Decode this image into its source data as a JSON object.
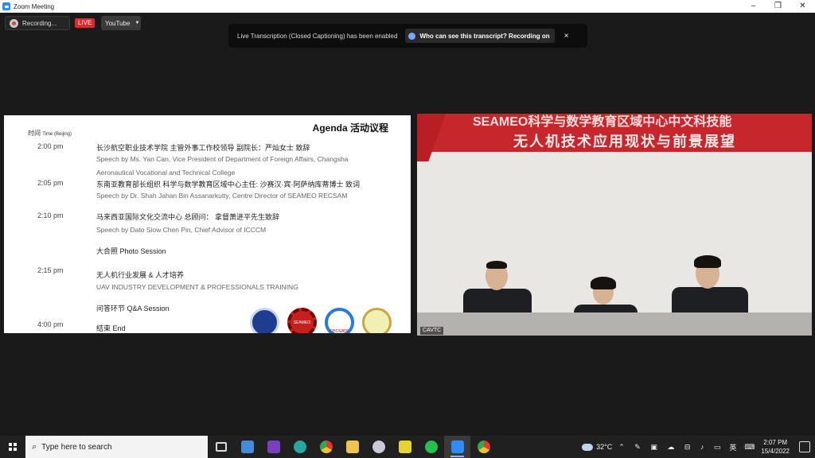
{
  "window": {
    "title": "Zoom Meeting"
  },
  "top_controls": {
    "recording_label": "Recording...",
    "live_badge": "LIVE",
    "stream_target": "YouTube"
  },
  "notification": {
    "message": "Live Transcription (Closed Captioning) has been enabled",
    "who_button": "Who can see this transcript? Recording on",
    "close": "×"
  },
  "slide": {
    "title": "Agenda 活动议程",
    "time_header": "时间",
    "time_header_sub": "Time (Beijing)",
    "items": [
      {
        "time": "2:00 pm",
        "zh": "长沙航空职业技术学院 主管外事工作校领导 副院长：严灿女士 致辞",
        "en": "Speech by Ms. Yan Can, Vice President of Department of Foreign Affairs, Changsha",
        "en2": "Aeronautical Vocational and Technical College"
      },
      {
        "time": "2:05 pm",
        "zh": "东南亚教育部长组织 科学与数学教育区域中心主任: 沙赛汉·宾·阿萨纳库蒂博士 致词",
        "en": "Speech by Dr. Shah Jahan Bin Assanarkutty, Centre Director of SEAMEO RECSAM",
        "en2": ""
      },
      {
        "time": "2:10 pm",
        "zh": "马来西亚国际文化交流中心 总顾问： 拿督萧进平先生致辞",
        "en": "Speech by Dato Siow Chen Pin, Chief Advisor of ICCCM",
        "en2": ""
      },
      {
        "time": "",
        "zh": "大合照 Photo Session",
        "en": "",
        "en2": ""
      },
      {
        "time": "2:15 pm",
        "zh": "无人机行业发展 & 人才培养",
        "en": "UAV INDUSTRY DEVELOPMENT & PROFESSIONALS TRAINING",
        "en2": ""
      },
      {
        "time": "",
        "zh": "问答环节 Q&A Session",
        "en": "",
        "en2": ""
      },
      {
        "time": "4:00 pm",
        "zh": "结束 End",
        "en": "",
        "en2": ""
      }
    ],
    "logo_labels": [
      "SEAMEO",
      "recsam"
    ]
  },
  "video": {
    "banner_line1": "SEAMEO科学与数学教育区域中心中文科技能",
    "banner_line2": "无人机技术应用现状与前景展望",
    "participant_name": "CAVTC"
  },
  "taskbar": {
    "search_placeholder": "Type here to search",
    "weather": "32°C",
    "ime": "英",
    "time": "2:07 PM",
    "date": "15/4/2022"
  }
}
